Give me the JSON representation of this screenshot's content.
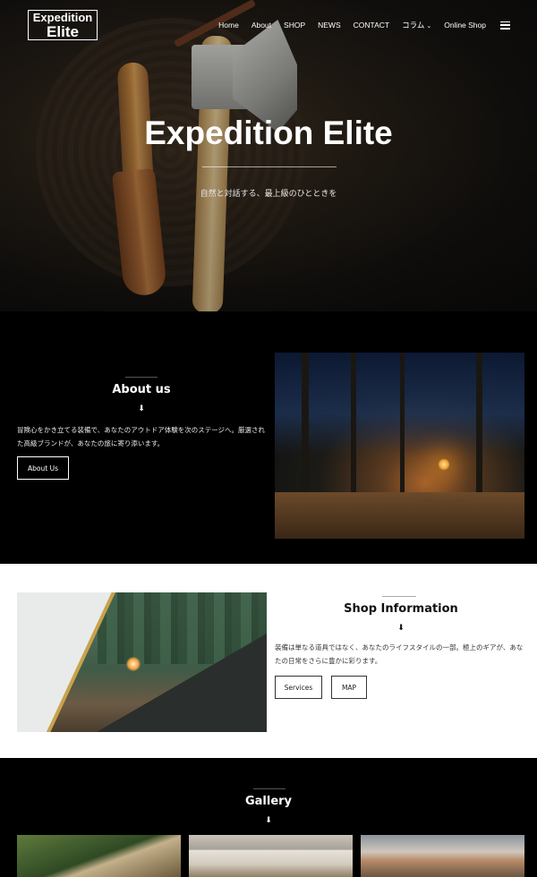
{
  "brand": {
    "line1": "Expedition",
    "line2": "Elite"
  },
  "nav": {
    "items": [
      "Home",
      "About",
      "SHOP",
      "NEWS",
      "CONTACT",
      "コラム",
      "Online Shop"
    ],
    "dropdown_indicator": "chevron-down-icon",
    "menu_icon": "hamburger-icon"
  },
  "hero": {
    "title": "Expedition Elite",
    "subtitle": "自然と対話する、最上級のひとときを"
  },
  "about": {
    "title": "About us",
    "arrow": "⬇",
    "description": "冒険心をかき立てる装備で、あなたのアウトドア体験を次のステージへ。厳選された高級ブランドが、あなたの旅に寄り添います。",
    "button": "About Us"
  },
  "shop": {
    "title": "Shop Information",
    "arrow": "⬇",
    "description": "装備は単なる道具ではなく、あなたのライフスタイルの一部。極上のギアが、あなたの日常をさらに豊かに彩ります。",
    "buttons": [
      "Services",
      "MAP"
    ]
  },
  "gallery": {
    "title": "Gallery",
    "arrow": "⬇"
  },
  "colors": {
    "dark_bg": "#000000",
    "light_bg": "#ffffff",
    "text_light": "#ffffff",
    "text_dark": "#222222"
  }
}
